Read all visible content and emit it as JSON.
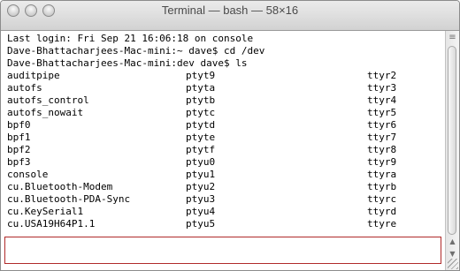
{
  "window": {
    "title": "Terminal — bash — 58×16"
  },
  "terminal": {
    "header_lines": [
      "Last login: Fri Sep 21 16:06:18 on console",
      "Dave-Bhattacharjees-Mac-mini:~ dave$ cd /dev",
      "Dave-Bhattacharjees-Mac-mini:dev dave$ ls"
    ],
    "rows": [
      [
        "auditpipe",
        "ptyt9",
        "ttyr2"
      ],
      [
        "autofs",
        "ptyta",
        "ttyr3"
      ],
      [
        "autofs_control",
        "ptytb",
        "ttyr4"
      ],
      [
        "autofs_nowait",
        "ptytc",
        "ttyr5"
      ],
      [
        "bpf0",
        "ptytd",
        "ttyr6"
      ],
      [
        "bpf1",
        "ptyte",
        "ttyr7"
      ],
      [
        "bpf2",
        "ptytf",
        "ttyr8"
      ],
      [
        "bpf3",
        "ptyu0",
        "ttyr9"
      ],
      [
        "console",
        "ptyu1",
        "ttyra"
      ],
      [
        "cu.Bluetooth-Modem",
        "ptyu2",
        "ttyrb"
      ],
      [
        "cu.Bluetooth-PDA-Sync",
        "ptyu3",
        "ttyrc"
      ],
      [
        "cu.KeySerial1",
        "ptyu4",
        "ttyrd"
      ],
      [
        "cu.USA19H64P1.1",
        "ptyu5",
        "ttyre"
      ]
    ]
  },
  "scrollbar": {
    "up_arrow": "▲",
    "down_arrow": "▼",
    "top_marker": "≡"
  },
  "colors": {
    "highlight_border": "#b02a2a"
  }
}
